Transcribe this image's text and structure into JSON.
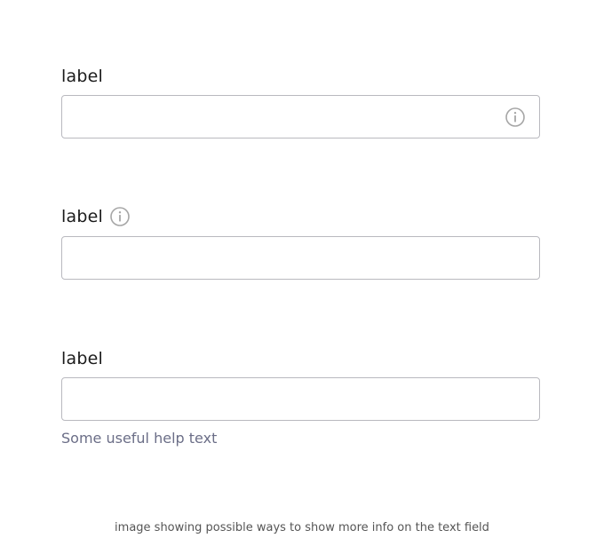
{
  "fields": [
    {
      "label": "label",
      "value": "",
      "info_icon": "info-icon",
      "info_placement": "inside-input"
    },
    {
      "label": "label",
      "value": "",
      "info_icon": "info-icon",
      "info_placement": "next-to-label"
    },
    {
      "label": "label",
      "value": "",
      "help_text": "Some useful help text"
    }
  ],
  "caption": "image showing possible ways to show more info on the text field",
  "colors": {
    "border": "#b9b9bf",
    "icon": "#a6a6a6",
    "help_text": "#6b6e87",
    "label": "#1b1b1b"
  }
}
